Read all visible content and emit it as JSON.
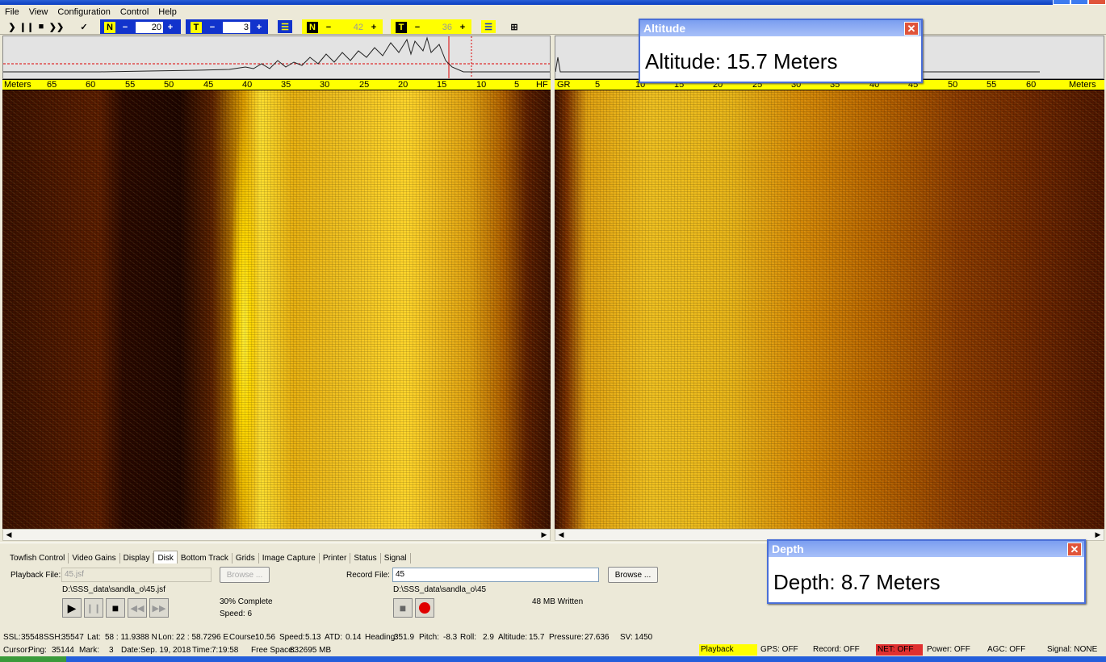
{
  "menu": [
    "File",
    "View",
    "Configuration",
    "Control",
    "Help"
  ],
  "toolbar": {
    "n1_value": "20",
    "t1_value": "3",
    "n2_value": "42",
    "t2_value": "36",
    "n_label": "N",
    "t_label": "T",
    "minus": "−",
    "plus": "+"
  },
  "scale_left": {
    "label": "Meters",
    "ticks": [
      "65",
      "60",
      "55",
      "50",
      "45",
      "40",
      "35",
      "30",
      "25",
      "20",
      "15",
      "10",
      "5"
    ],
    "end": "HF"
  },
  "scale_right": {
    "label": "GR",
    "ticks": [
      "5",
      "10",
      "15",
      "20",
      "25",
      "30",
      "35",
      "40",
      "45",
      "50",
      "55",
      "60"
    ],
    "end": "Meters"
  },
  "altitude": {
    "title": "Altitude",
    "text": "Altitude:   15.7 Meters"
  },
  "depth": {
    "title": "Depth",
    "text": "Depth:    8.7 Meters"
  },
  "tabs": [
    "Towfish Control",
    "Video Gains",
    "Display",
    "Disk",
    "Bottom Track",
    "Grids",
    "Image Capture",
    "Printer",
    "Status",
    "Signal"
  ],
  "disk": {
    "playback_label": "Playback File:",
    "playback_value": "45.jsf",
    "browse1": "Browse ...",
    "playback_path": "D:\\SSS_data\\sandla_o\\45.jsf",
    "progress": "30% Complete",
    "speed": "Speed: 6",
    "record_label": "Record File:",
    "record_value": "45",
    "browse2": "Browse ...",
    "record_path": "D:\\SSS_data\\sandla_o\\45",
    "written": "48 MB Written"
  },
  "status1": [
    {
      "k": "SSL:",
      "v": "35548"
    },
    {
      "k": "SSH:",
      "v": "35547"
    },
    {
      "k": "Lat:",
      "v": "58 : 11.9388 N"
    },
    {
      "k": "Lon:",
      "v": "22 : 58.7296 E"
    },
    {
      "k": "Course:",
      "v": "10.56"
    },
    {
      "k": "Speed:",
      "v": "5.13"
    },
    {
      "k": "ATD:",
      "v": "0.14"
    },
    {
      "k": "Heading:",
      "v": "351.9"
    },
    {
      "k": "Pitch:",
      "v": "-8.3"
    },
    {
      "k": "Roll:",
      "v": "2.9"
    },
    {
      "k": "Altitude:",
      "v": "15.7"
    },
    {
      "k": "Pressure:",
      "v": "27.636"
    },
    {
      "k": "SV:",
      "v": "1450"
    }
  ],
  "status2": {
    "cursor": "Cursor:",
    "ping_k": "Ping:",
    "ping_v": "35144",
    "mark_k": "Mark:",
    "mark_v": "3",
    "date_k": "Date:",
    "date_v": "Sep. 19, 2018",
    "time_k": "Time:",
    "time_v": "7:19:58",
    "free_k": "Free Space:",
    "free_v": "832695 MB"
  },
  "indicators": [
    {
      "text": "Playback",
      "color": "#ffff00"
    },
    {
      "text": "GPS: OFF",
      "color": "#ece9d8"
    },
    {
      "text": "Record: OFF",
      "color": "#ece9d8"
    },
    {
      "text": "NET: OFF",
      "color": "#e03030"
    },
    {
      "text": "Power: OFF",
      "color": "#ece9d8"
    },
    {
      "text": "AGC: OFF",
      "color": "#ece9d8"
    },
    {
      "text": "Signal: NONE",
      "color": "#ece9d8"
    }
  ]
}
